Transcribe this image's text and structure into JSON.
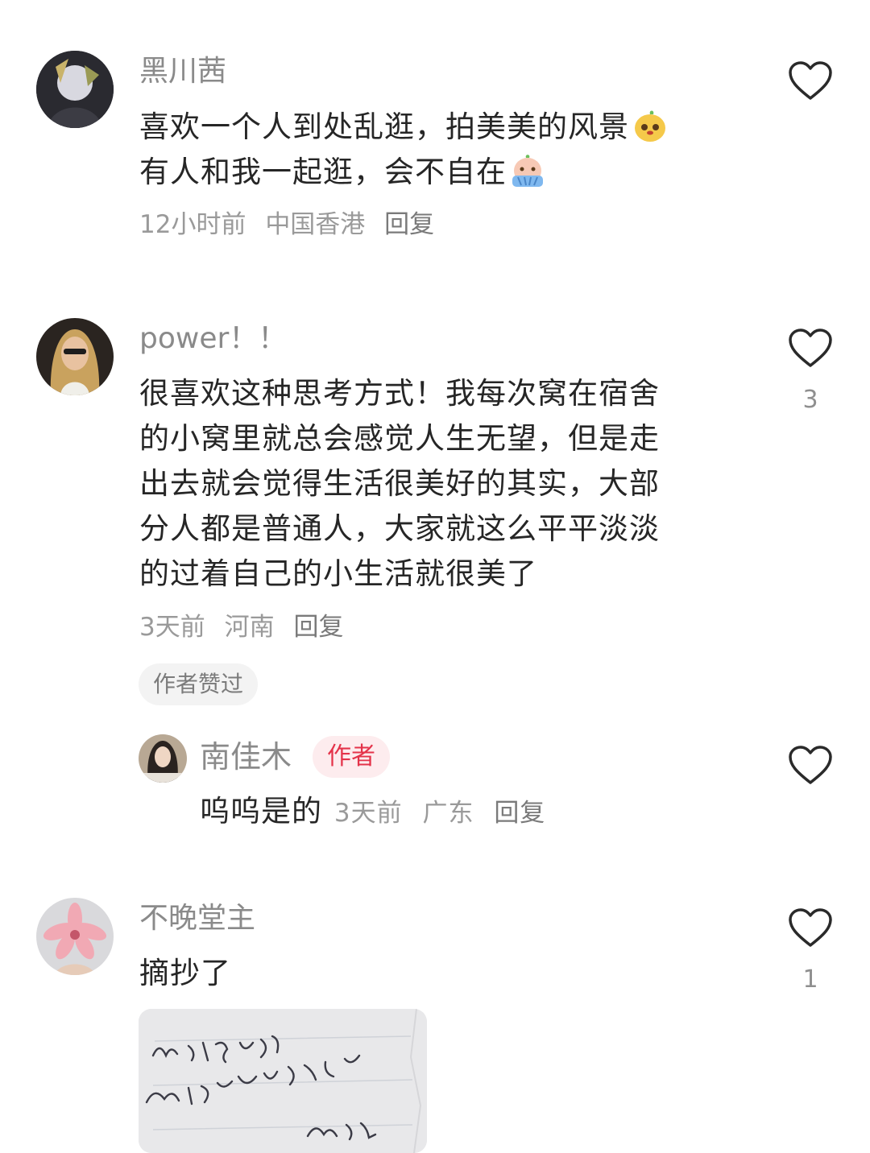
{
  "comments": [
    {
      "username": "黑川茜",
      "text_line1": "喜欢一个人到处乱逛，拍美美的风景",
      "text_line2": "有人和我一起逛，会不自在",
      "time": "12小时前",
      "location": "中国香港",
      "reply_label": "回复",
      "likes": ""
    },
    {
      "username": "power！！",
      "text_lines": [
        "很喜欢这种思考方式！我每次窝在宿舍",
        "的小窝里就总会感觉人生无望，但是走",
        "出去就会觉得生活很美好的其实，大部",
        "分人都是普通人，大家就这么平平淡淡",
        "的过着自己的小生活就很美了"
      ],
      "time": "3天前",
      "location": "河南",
      "reply_label": "回复",
      "likes": "3",
      "badge": "作者赞过",
      "sub_reply": {
        "username": "南佳木",
        "author_tag": "作者",
        "text": "呜呜是的",
        "time": "3天前",
        "location": "广东",
        "reply_label": "回复"
      }
    },
    {
      "username": "不晚堂主",
      "text": "摘抄了",
      "likes": "1",
      "photo_note": "出门不是逃避\n而是主动选择该世界\n蔡澜"
    }
  ],
  "icons": {
    "like": "heart-outline-icon",
    "emoji1": "yellow-face-emoji-icon",
    "emoji2": "crying-face-emoji-icon"
  },
  "colors": {
    "text": "#262626",
    "muted": "#8a8a8a",
    "author_red": "#e4334a"
  }
}
